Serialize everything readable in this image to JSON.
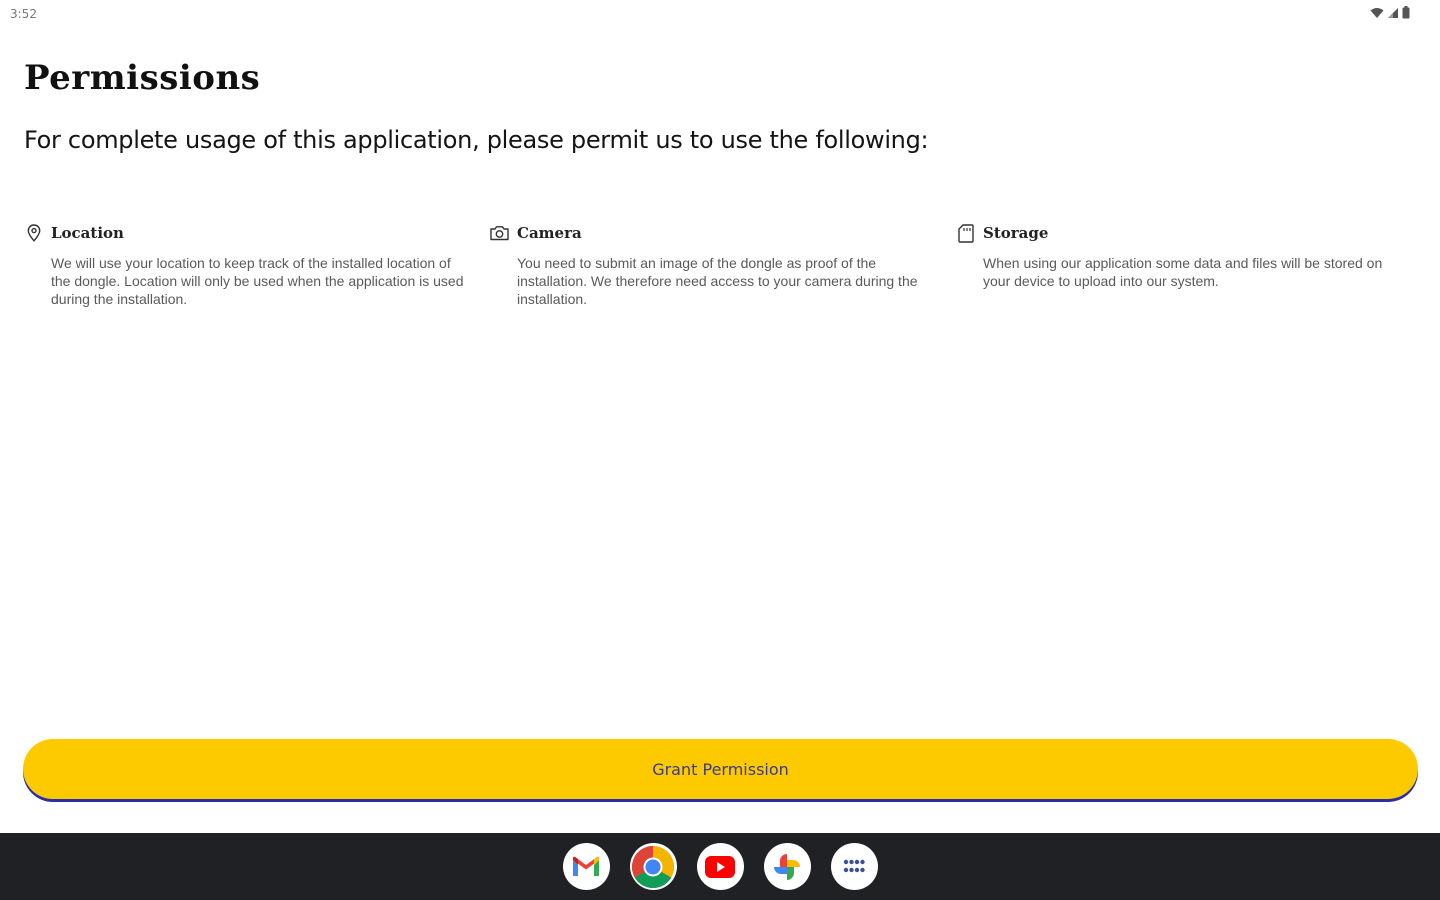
{
  "status_bar": {
    "time": "3:52",
    "icons": [
      "wifi-icon",
      "signal-icon",
      "battery-icon"
    ]
  },
  "header": {
    "title": "Permissions",
    "subtitle": "For complete usage of this application, please permit us to use the following:"
  },
  "permissions": [
    {
      "icon": "location-pin-icon",
      "title": "Location",
      "description": "We will use your location to keep track of the installed location of the dongle. Location will only be used when the application is used during the installation."
    },
    {
      "icon": "camera-icon",
      "title": "Camera",
      "description": "You need to submit an image of the dongle as proof of the installation. We therefore need access to your camera during the installation."
    },
    {
      "icon": "sd-card-icon",
      "title": "Storage",
      "description": "When using our application some data and files will be stored on your device to upload into our system."
    }
  ],
  "actions": {
    "grant_label": "Grant Permission"
  },
  "taskbar": {
    "apps": [
      "gmail-icon",
      "chrome-icon",
      "youtube-icon",
      "photos-icon",
      "app-launcher-icon"
    ]
  },
  "colors": {
    "accent_button": "#fdca00",
    "button_shadow": "#2b2ca6",
    "taskbar_bg": "#202124"
  }
}
